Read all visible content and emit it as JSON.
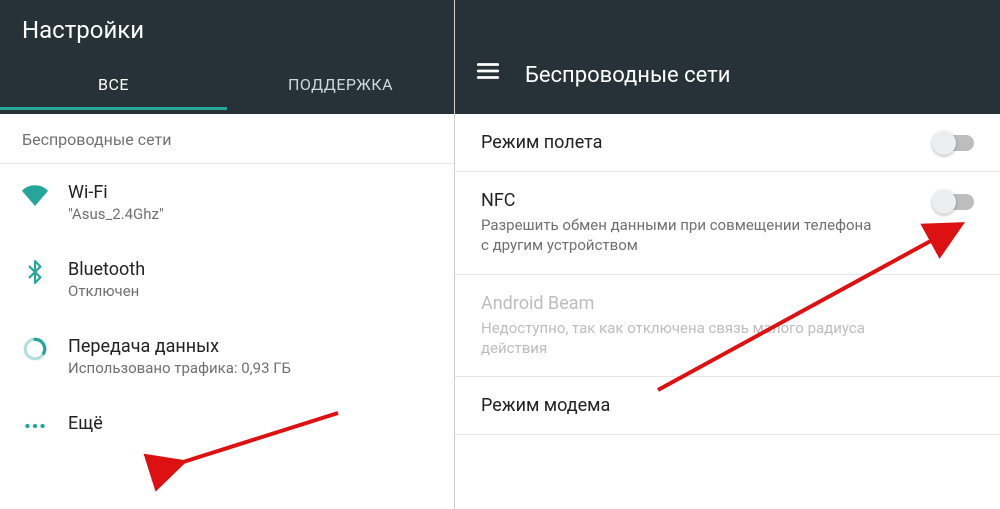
{
  "left": {
    "title": "Настройки",
    "tabs": {
      "all": "ВСЕ",
      "support": "ПОДДЕРЖКА"
    },
    "section": "Беспроводные сети",
    "items": {
      "wifi": {
        "label": "Wi-Fi",
        "sub": "\"Asus_2.4Ghz\""
      },
      "bt": {
        "label": "Bluetooth",
        "sub": "Отключен"
      },
      "data": {
        "label": "Передача данных",
        "sub": "Использовано трафика: 0,93 ГБ"
      },
      "more": {
        "label": "Ещё"
      }
    }
  },
  "right": {
    "title": "Беспроводные сети",
    "items": {
      "airplane": {
        "label": "Режим полета"
      },
      "nfc": {
        "label": "NFC",
        "sub": "Разрешить обмен данными при совмещении телефона с другим устройством"
      },
      "beam": {
        "label": "Android Beam",
        "sub": "Недоступно, так как отключена связь малого радиуса действия"
      },
      "tether": {
        "label": "Режим модема"
      }
    }
  }
}
